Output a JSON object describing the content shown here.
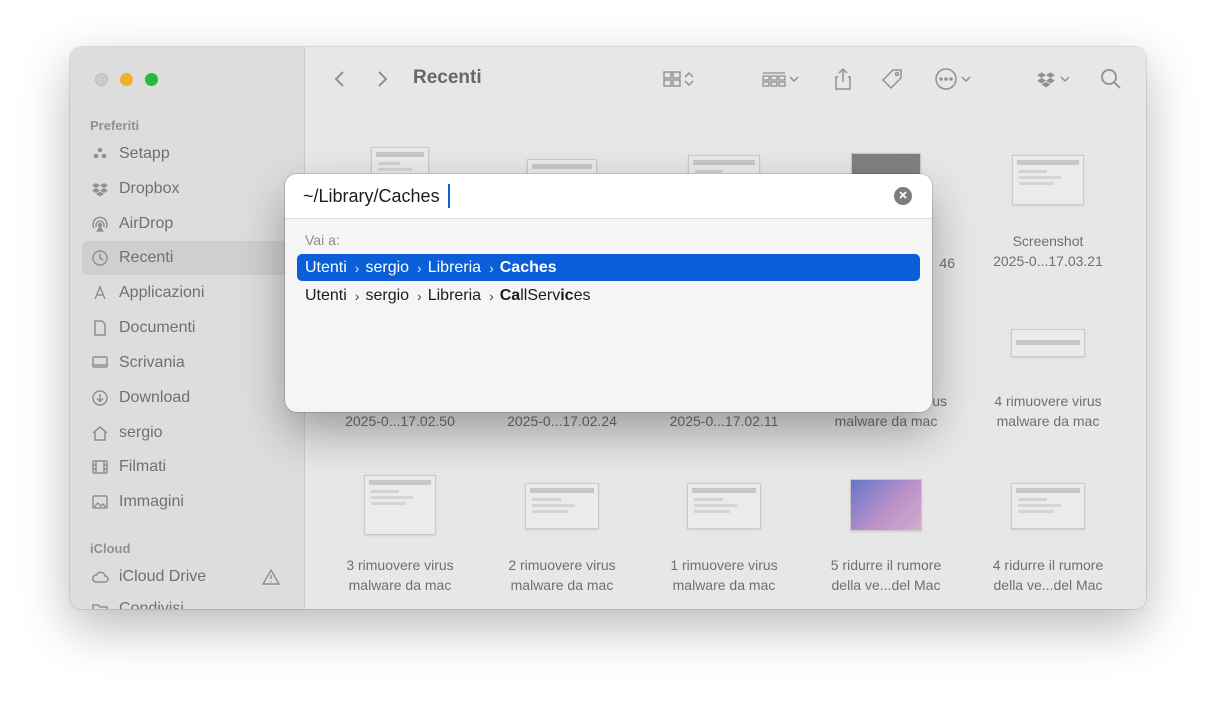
{
  "window": {
    "toolbar_title": "Recenti"
  },
  "sidebar": {
    "favorites_header": "Preferiti",
    "items": [
      {
        "label": "Setapp",
        "icon": "setapp-icon"
      },
      {
        "label": "Dropbox",
        "icon": "dropbox-icon"
      },
      {
        "label": "AirDrop",
        "icon": "airdrop-icon"
      },
      {
        "label": "Recenti",
        "icon": "clock-icon",
        "active": true
      },
      {
        "label": "Applicazioni",
        "icon": "applications-icon"
      },
      {
        "label": "Documenti",
        "icon": "document-icon"
      },
      {
        "label": "Scrivania",
        "icon": "desktop-icon"
      },
      {
        "label": "Download",
        "icon": "download-icon"
      },
      {
        "label": "sergio",
        "icon": "home-icon"
      },
      {
        "label": "Filmati",
        "icon": "film-icon"
      },
      {
        "label": "Immagini",
        "icon": "photo-icon"
      }
    ],
    "icloud_header": "iCloud",
    "icloud_items": [
      {
        "label": "iCloud Drive",
        "icon": "cloud-icon"
      },
      {
        "label": "Condivisi",
        "icon": "shared-folder-icon"
      }
    ]
  },
  "files": {
    "row1": [
      {
        "line1": "",
        "line2": ""
      },
      {
        "line1": "",
        "line2": ""
      },
      {
        "line1": "",
        "line2": ""
      },
      {
        "line1": "",
        "line2": "46"
      },
      {
        "line1": "Screenshot",
        "line2": "2025-0...17.03.21"
      }
    ],
    "row2": [
      {
        "line1": "",
        "line2": "2025-0...17.02.50"
      },
      {
        "line1": "",
        "line2": "2025-0...17.02.24"
      },
      {
        "line1": "",
        "line2": "2025-0...17.02.11"
      },
      {
        "line1": "us",
        "line2": "malware da mac"
      },
      {
        "line1": "4 rimuovere virus",
        "line2": "malware da mac"
      }
    ],
    "row3": [
      {
        "line1": "3 rimuovere virus",
        "line2": "malware da mac"
      },
      {
        "line1": "2 rimuovere virus",
        "line2": "malware da mac"
      },
      {
        "line1": "1 rimuovere virus",
        "line2": "malware da mac"
      },
      {
        "line1": "5 ridurre il rumore",
        "line2": "della ve...del Mac"
      },
      {
        "line1": "4 ridurre il rumore",
        "line2": "della ve...del Mac"
      }
    ]
  },
  "goto_dialog": {
    "path_value": "~/Library/Caches",
    "goto_label": "Vai a:",
    "suggestions": [
      {
        "segments": [
          "Utenti",
          "sergio",
          "Libreria"
        ],
        "last_bold": "Caches",
        "last_rest": ""
      },
      {
        "segments": [
          "Utenti",
          "sergio",
          "Libreria"
        ],
        "last_parts": [
          "Ca",
          "llServ",
          "ic",
          "es"
        ]
      }
    ]
  },
  "colors": {
    "selection": "#0a5fd9",
    "traffic_min": "#febc2e",
    "traffic_max": "#28c840"
  }
}
